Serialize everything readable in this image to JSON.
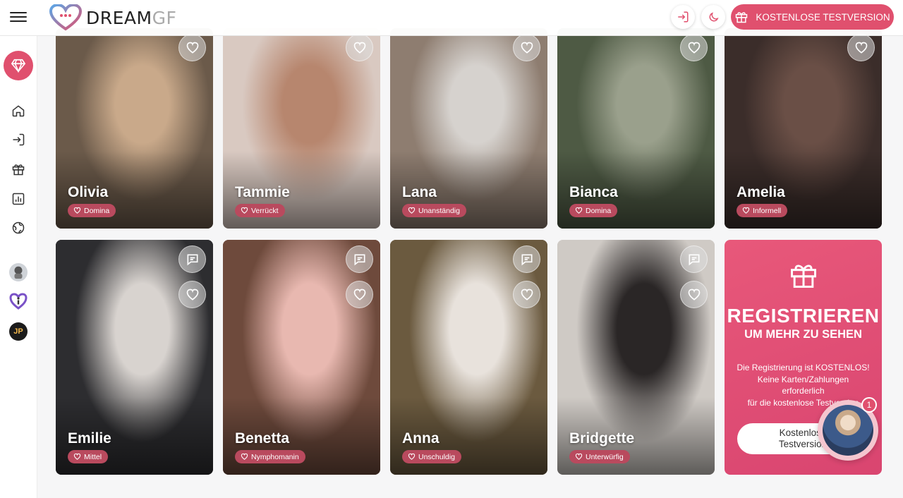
{
  "header": {
    "logo_text_a": "DREAM",
    "logo_text_b": "GF",
    "trial_button": "KOSTENLOSE TESTVERSION"
  },
  "sidebar": {
    "items": [
      {
        "name": "home-icon"
      },
      {
        "name": "login-icon"
      },
      {
        "name": "gift-icon"
      },
      {
        "name": "chart-icon"
      },
      {
        "name": "globe-icon"
      }
    ],
    "avatar_jp": "JP"
  },
  "cards": [
    {
      "name": "Olivia",
      "tag": "Domina",
      "tag_icon": "domina-icon",
      "bg": "#6b5a4a",
      "accent": "#c9a98a"
    },
    {
      "name": "Tammie",
      "tag": "Verrückt",
      "tag_icon": "flame-icon",
      "bg": "#d9c9c1",
      "accent": "#b7866e"
    },
    {
      "name": "Lana",
      "tag": "Unanständig",
      "tag_icon": "lips-icon",
      "bg": "#8e7d70",
      "accent": "#d6d2ce"
    },
    {
      "name": "Bianca",
      "tag": "Domina",
      "tag_icon": "domina-icon",
      "bg": "#4e5a44",
      "accent": "#9aa08c"
    },
    {
      "name": "Amelia",
      "tag": "Informell",
      "tag_icon": "heart-hand-icon",
      "bg": "#3b2d2a",
      "accent": "#6a4f46"
    },
    {
      "name": "Emilie",
      "tag": "Mittel",
      "tag_icon": "mittel-icon",
      "bg": "#2d2d30",
      "accent": "#d8d3cf"
    },
    {
      "name": "Benetta",
      "tag": "Nymphomanin",
      "tag_icon": "flame-icon",
      "bg": "#6e4a3c",
      "accent": "#e8b8b0"
    },
    {
      "name": "Anna",
      "tag": "Unschuldig",
      "tag_icon": "innocent-icon",
      "bg": "#6b5a3f",
      "accent": "#e8e2dc"
    },
    {
      "name": "Bridgette",
      "tag": "Unterwürfig",
      "tag_icon": "submissive-icon",
      "bg": "#cfcac5",
      "accent": "#2a2626"
    }
  ],
  "register": {
    "title": "REGISTRIEREN",
    "subtitle": "UM MEHR ZU SEHEN",
    "line1": "Die Registrierung ist KOSTENLOS!",
    "line2": "Keine Karten/Zahlungen",
    "line3": "erforderlich",
    "line4": "für die kostenlose Testversion",
    "button_line1": "Kostenlose",
    "button_line2": "Testversion"
  },
  "chat_badge": "1",
  "colors": {
    "accent": "#e0506e",
    "tag": "#b94a5e"
  }
}
